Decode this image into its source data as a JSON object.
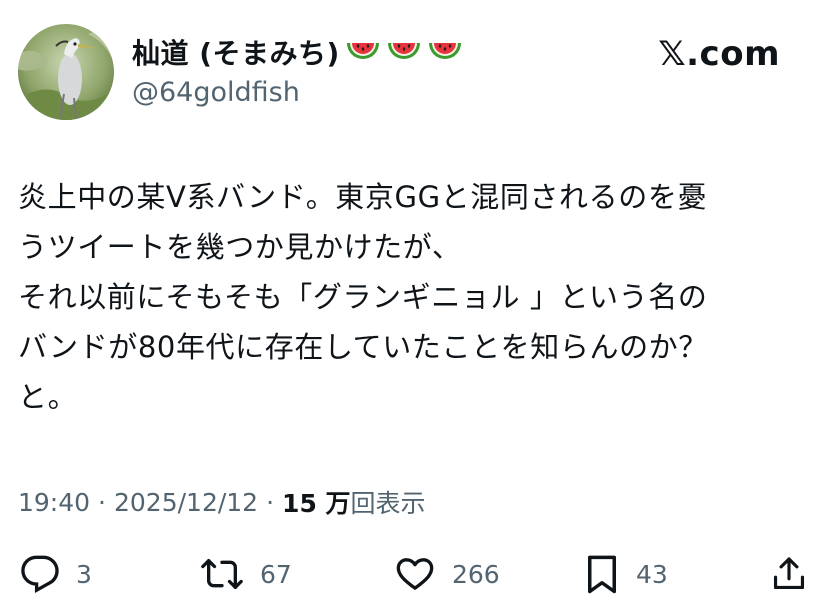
{
  "author": {
    "display_name": "杣道 (そまみち)",
    "name_emojis": [
      "watermelon-icon",
      "watermelon-icon",
      "watermelon-icon"
    ],
    "handle": "@64goldfish",
    "avatar": "heron-photo-avatar"
  },
  "brand": {
    "label": "𝕏.com"
  },
  "tweet": {
    "lines": [
      "炎上中の某V系バンド。東京GGと混同されるのを憂",
      "うツイートを幾つか見かけたが、",
      "それ以前にそもそも「グランギニョル 」という名の",
      "バンドが80年代に存在していたことを知らんのか？",
      "と。"
    ]
  },
  "meta": {
    "time": "19:40",
    "separator": "·",
    "date": "2025/12/12",
    "views_count": "15 万",
    "views_label": "回表示"
  },
  "actions": {
    "reply": {
      "icon": "reply-icon",
      "count": "3"
    },
    "repost": {
      "icon": "repost-icon",
      "count": "67"
    },
    "like": {
      "icon": "heart-icon",
      "count": "266"
    },
    "bookmark": {
      "icon": "bookmark-icon",
      "count": "43"
    },
    "share": {
      "icon": "share-icon"
    }
  },
  "colors": {
    "text": "#0f1419",
    "secondary": "#536471",
    "background": "#ffffff"
  }
}
